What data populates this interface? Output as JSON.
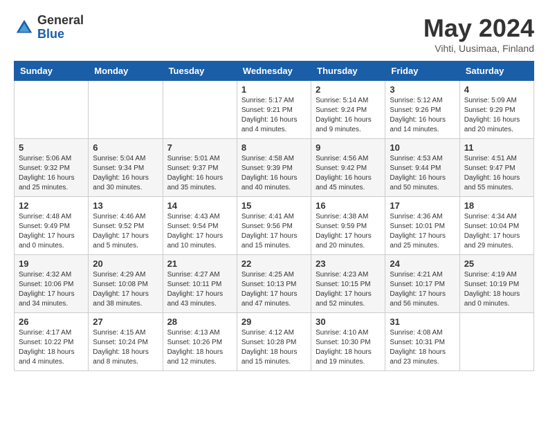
{
  "logo": {
    "general": "General",
    "blue": "Blue"
  },
  "title": {
    "month_year": "May 2024",
    "location": "Vihti, Uusimaa, Finland"
  },
  "headers": [
    "Sunday",
    "Monday",
    "Tuesday",
    "Wednesday",
    "Thursday",
    "Friday",
    "Saturday"
  ],
  "weeks": [
    [
      {
        "day": "",
        "info": ""
      },
      {
        "day": "",
        "info": ""
      },
      {
        "day": "",
        "info": ""
      },
      {
        "day": "1",
        "info": "Sunrise: 5:17 AM\nSunset: 9:21 PM\nDaylight: 16 hours\nand 4 minutes."
      },
      {
        "day": "2",
        "info": "Sunrise: 5:14 AM\nSunset: 9:24 PM\nDaylight: 16 hours\nand 9 minutes."
      },
      {
        "day": "3",
        "info": "Sunrise: 5:12 AM\nSunset: 9:26 PM\nDaylight: 16 hours\nand 14 minutes."
      },
      {
        "day": "4",
        "info": "Sunrise: 5:09 AM\nSunset: 9:29 PM\nDaylight: 16 hours\nand 20 minutes."
      }
    ],
    [
      {
        "day": "5",
        "info": "Sunrise: 5:06 AM\nSunset: 9:32 PM\nDaylight: 16 hours\nand 25 minutes."
      },
      {
        "day": "6",
        "info": "Sunrise: 5:04 AM\nSunset: 9:34 PM\nDaylight: 16 hours\nand 30 minutes."
      },
      {
        "day": "7",
        "info": "Sunrise: 5:01 AM\nSunset: 9:37 PM\nDaylight: 16 hours\nand 35 minutes."
      },
      {
        "day": "8",
        "info": "Sunrise: 4:58 AM\nSunset: 9:39 PM\nDaylight: 16 hours\nand 40 minutes."
      },
      {
        "day": "9",
        "info": "Sunrise: 4:56 AM\nSunset: 9:42 PM\nDaylight: 16 hours\nand 45 minutes."
      },
      {
        "day": "10",
        "info": "Sunrise: 4:53 AM\nSunset: 9:44 PM\nDaylight: 16 hours\nand 50 minutes."
      },
      {
        "day": "11",
        "info": "Sunrise: 4:51 AM\nSunset: 9:47 PM\nDaylight: 16 hours\nand 55 minutes."
      }
    ],
    [
      {
        "day": "12",
        "info": "Sunrise: 4:48 AM\nSunset: 9:49 PM\nDaylight: 17 hours\nand 0 minutes."
      },
      {
        "day": "13",
        "info": "Sunrise: 4:46 AM\nSunset: 9:52 PM\nDaylight: 17 hours\nand 5 minutes."
      },
      {
        "day": "14",
        "info": "Sunrise: 4:43 AM\nSunset: 9:54 PM\nDaylight: 17 hours\nand 10 minutes."
      },
      {
        "day": "15",
        "info": "Sunrise: 4:41 AM\nSunset: 9:56 PM\nDaylight: 17 hours\nand 15 minutes."
      },
      {
        "day": "16",
        "info": "Sunrise: 4:38 AM\nSunset: 9:59 PM\nDaylight: 17 hours\nand 20 minutes."
      },
      {
        "day": "17",
        "info": "Sunrise: 4:36 AM\nSunset: 10:01 PM\nDaylight: 17 hours\nand 25 minutes."
      },
      {
        "day": "18",
        "info": "Sunrise: 4:34 AM\nSunset: 10:04 PM\nDaylight: 17 hours\nand 29 minutes."
      }
    ],
    [
      {
        "day": "19",
        "info": "Sunrise: 4:32 AM\nSunset: 10:06 PM\nDaylight: 17 hours\nand 34 minutes."
      },
      {
        "day": "20",
        "info": "Sunrise: 4:29 AM\nSunset: 10:08 PM\nDaylight: 17 hours\nand 38 minutes."
      },
      {
        "day": "21",
        "info": "Sunrise: 4:27 AM\nSunset: 10:11 PM\nDaylight: 17 hours\nand 43 minutes."
      },
      {
        "day": "22",
        "info": "Sunrise: 4:25 AM\nSunset: 10:13 PM\nDaylight: 17 hours\nand 47 minutes."
      },
      {
        "day": "23",
        "info": "Sunrise: 4:23 AM\nSunset: 10:15 PM\nDaylight: 17 hours\nand 52 minutes."
      },
      {
        "day": "24",
        "info": "Sunrise: 4:21 AM\nSunset: 10:17 PM\nDaylight: 17 hours\nand 56 minutes."
      },
      {
        "day": "25",
        "info": "Sunrise: 4:19 AM\nSunset: 10:19 PM\nDaylight: 18 hours\nand 0 minutes."
      }
    ],
    [
      {
        "day": "26",
        "info": "Sunrise: 4:17 AM\nSunset: 10:22 PM\nDaylight: 18 hours\nand 4 minutes."
      },
      {
        "day": "27",
        "info": "Sunrise: 4:15 AM\nSunset: 10:24 PM\nDaylight: 18 hours\nand 8 minutes."
      },
      {
        "day": "28",
        "info": "Sunrise: 4:13 AM\nSunset: 10:26 PM\nDaylight: 18 hours\nand 12 minutes."
      },
      {
        "day": "29",
        "info": "Sunrise: 4:12 AM\nSunset: 10:28 PM\nDaylight: 18 hours\nand 15 minutes."
      },
      {
        "day": "30",
        "info": "Sunrise: 4:10 AM\nSunset: 10:30 PM\nDaylight: 18 hours\nand 19 minutes."
      },
      {
        "day": "31",
        "info": "Sunrise: 4:08 AM\nSunset: 10:31 PM\nDaylight: 18 hours\nand 23 minutes."
      },
      {
        "day": "",
        "info": ""
      }
    ]
  ]
}
